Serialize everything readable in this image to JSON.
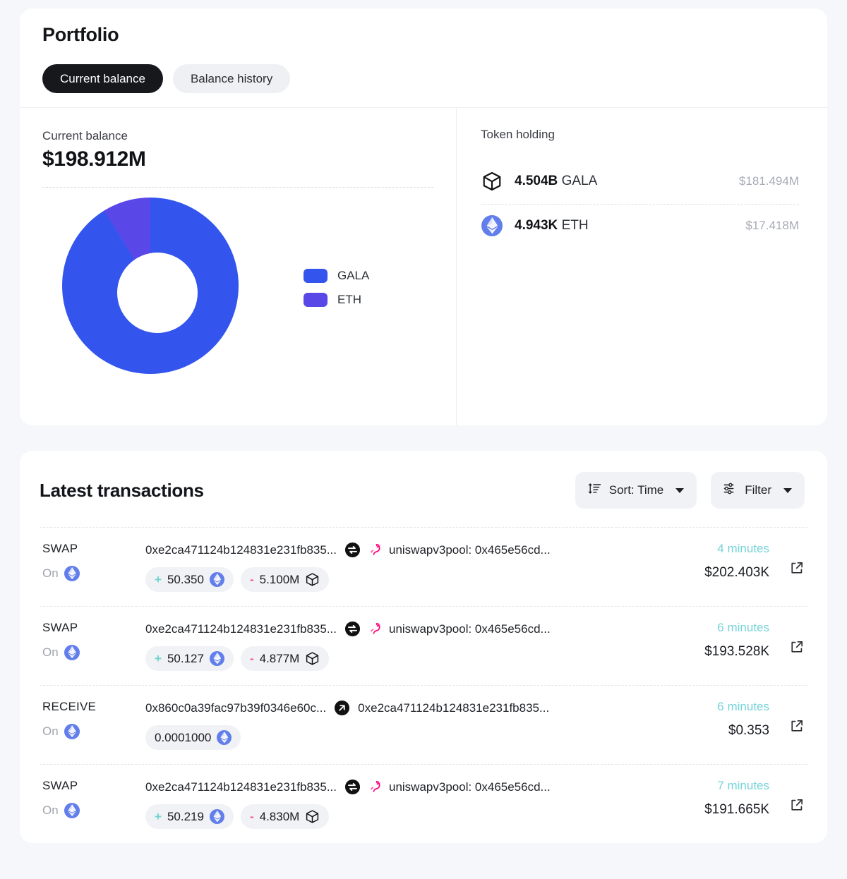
{
  "header": {
    "title": "Portfolio",
    "tabs": [
      {
        "label": "Current balance",
        "active": true
      },
      {
        "label": "Balance history",
        "active": false
      }
    ]
  },
  "balance": {
    "label": "Current balance",
    "amount": "$198.912M"
  },
  "chart_data": {
    "type": "pie",
    "title": "Current balance",
    "labels": [
      "GALA",
      "ETH"
    ],
    "values": [
      181.494,
      17.418
    ],
    "units": "USD millions",
    "percentages": [
      91.24,
      8.76
    ],
    "colors": [
      "#3355ee",
      "#5a47e8"
    ],
    "legend": [
      "GALA",
      "ETH"
    ],
    "legend_position": "right",
    "donut": true,
    "inner_radius_ratio": 0.455,
    "start_angle_deg": 0,
    "direction": "clockwise"
  },
  "token_holding": {
    "title": "Token holding",
    "rows": [
      {
        "icon": "gala-cube-icon",
        "amount": "4.504B",
        "symbol": "GALA",
        "usd": "$181.494M"
      },
      {
        "icon": "eth-diamond-icon",
        "amount": "4.943K",
        "symbol": "ETH",
        "usd": "$17.418M"
      }
    ]
  },
  "transactions": {
    "title": "Latest transactions",
    "sort_label": "Sort: Time",
    "filter_label": "Filter",
    "rows": [
      {
        "type": "SWAP",
        "on_label": "On",
        "chain_icon": "eth-diamond-icon",
        "from": "0xe2ca471124b124831e231fb835...",
        "action_icon": "swap-icon",
        "dest_icon": "uniswap-unicorn-icon",
        "to": "uniswapv3pool: 0x465e56cd...",
        "amounts": [
          {
            "sign": "+",
            "value": "50.350",
            "token_icon": "eth-diamond-icon"
          },
          {
            "sign": "-",
            "value": "5.100M",
            "token_icon": "gala-cube-icon"
          }
        ],
        "time": "4 minutes",
        "usd": "$202.403K",
        "link_icon": "external-link-icon"
      },
      {
        "type": "SWAP",
        "on_label": "On",
        "chain_icon": "eth-diamond-icon",
        "from": "0xe2ca471124b124831e231fb835...",
        "action_icon": "swap-icon",
        "dest_icon": "uniswap-unicorn-icon",
        "to": "uniswapv3pool: 0x465e56cd...",
        "amounts": [
          {
            "sign": "+",
            "value": "50.127",
            "token_icon": "eth-diamond-icon"
          },
          {
            "sign": "-",
            "value": "4.877M",
            "token_icon": "gala-cube-icon"
          }
        ],
        "time": "6 minutes",
        "usd": "$193.528K",
        "link_icon": "external-link-icon"
      },
      {
        "type": "RECEIVE",
        "on_label": "On",
        "chain_icon": "eth-diamond-icon",
        "from": "0x860c0a39fac97b39f0346e60c...",
        "action_icon": "arrow-transfer-icon",
        "dest_icon": "",
        "to": "0xe2ca471124b124831e231fb835...",
        "amounts": [
          {
            "sign": "",
            "value": "0.0001000",
            "token_icon": "eth-diamond-icon"
          }
        ],
        "time": "6 minutes",
        "usd": "$0.353",
        "link_icon": "external-link-icon"
      },
      {
        "type": "SWAP",
        "on_label": "On",
        "chain_icon": "eth-diamond-icon",
        "from": "0xe2ca471124b124831e231fb835...",
        "action_icon": "swap-icon",
        "dest_icon": "uniswap-unicorn-icon",
        "to": "uniswapv3pool: 0x465e56cd...",
        "amounts": [
          {
            "sign": "+",
            "value": "50.219",
            "token_icon": "eth-diamond-icon"
          },
          {
            "sign": "-",
            "value": "4.830M",
            "token_icon": "gala-cube-icon"
          }
        ],
        "time": "7 minutes",
        "usd": "$191.665K",
        "link_icon": "external-link-icon"
      }
    ]
  }
}
